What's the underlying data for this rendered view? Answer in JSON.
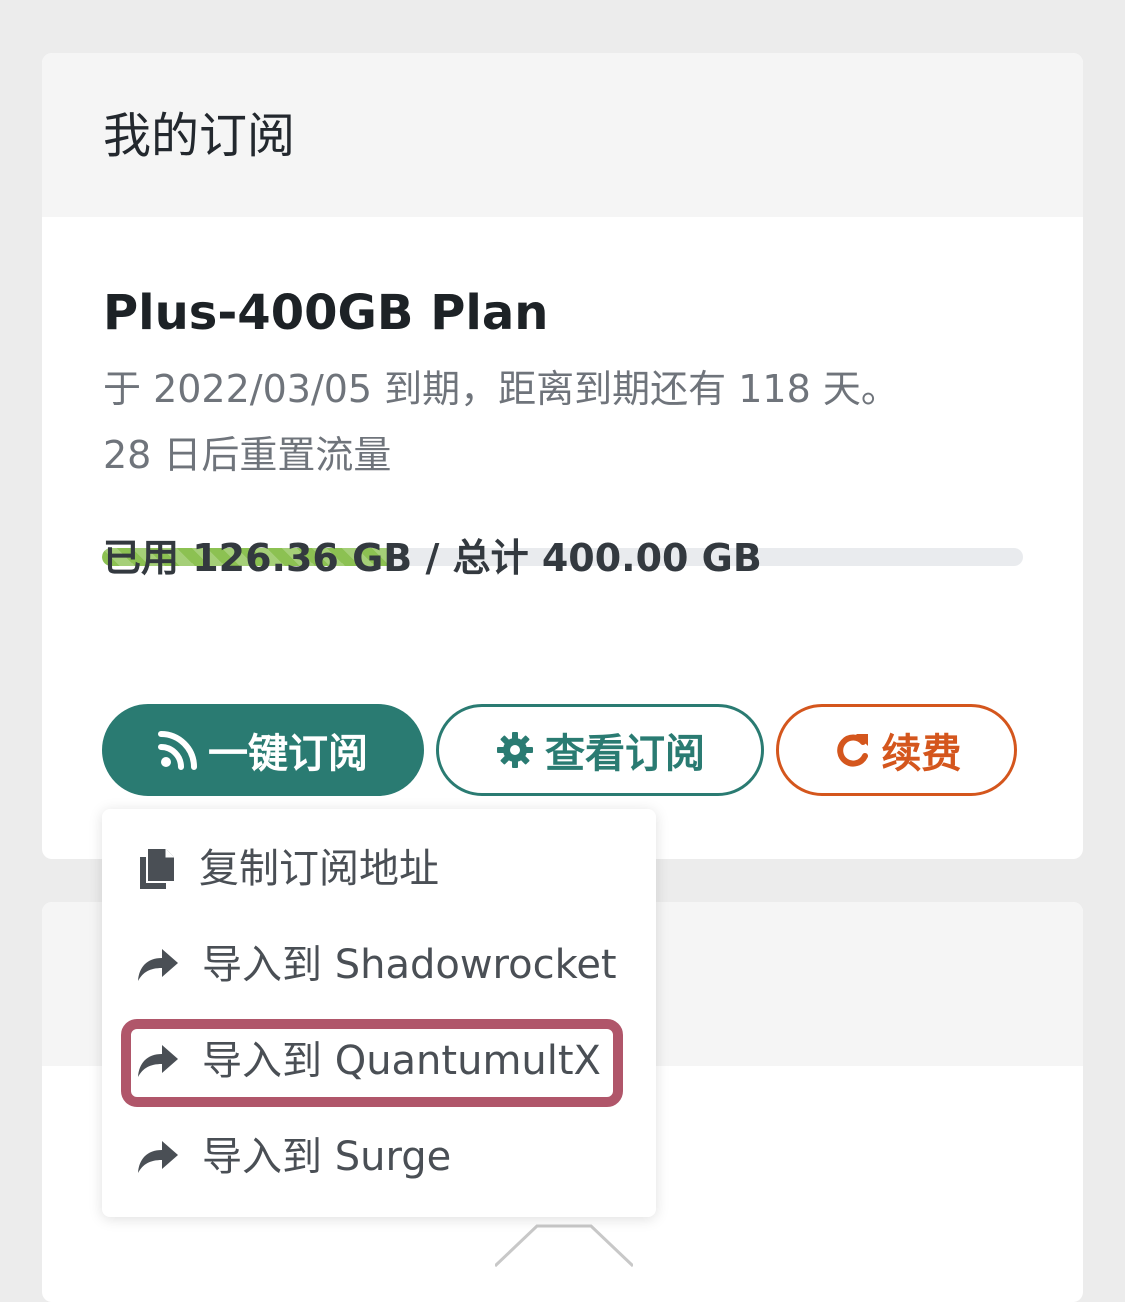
{
  "subscription_card": {
    "title": "我的订阅",
    "plan_name": "Plus-400GB Plan",
    "expiry_text": "于 2022/03/05 到期，距离到期还有 118 天。",
    "reset_text": "28 日后重置流量",
    "usage": {
      "used_fraction": 0.316,
      "label": "已用 126.36 GB / 总计 400.00 GB"
    },
    "buttons": {
      "one_click_subscribe": "一键订阅",
      "view_subscription": "查看订阅",
      "renew": "续费"
    }
  },
  "dropdown": {
    "items": [
      {
        "label": "复制订阅地址",
        "icon": "copy-icon"
      },
      {
        "label": "导入到 Shadowrocket",
        "icon": "share-arrow-icon"
      },
      {
        "label": "导入到 QuantumultX",
        "icon": "share-arrow-icon",
        "highlighted": true
      },
      {
        "label": "导入到 Surge",
        "icon": "share-arrow-icon"
      }
    ]
  },
  "colors": {
    "primary_teal": "#2a7b72",
    "renew_orange": "#d4561d",
    "progress_green": "#8cc152",
    "highlight_box": "#b0566a"
  }
}
